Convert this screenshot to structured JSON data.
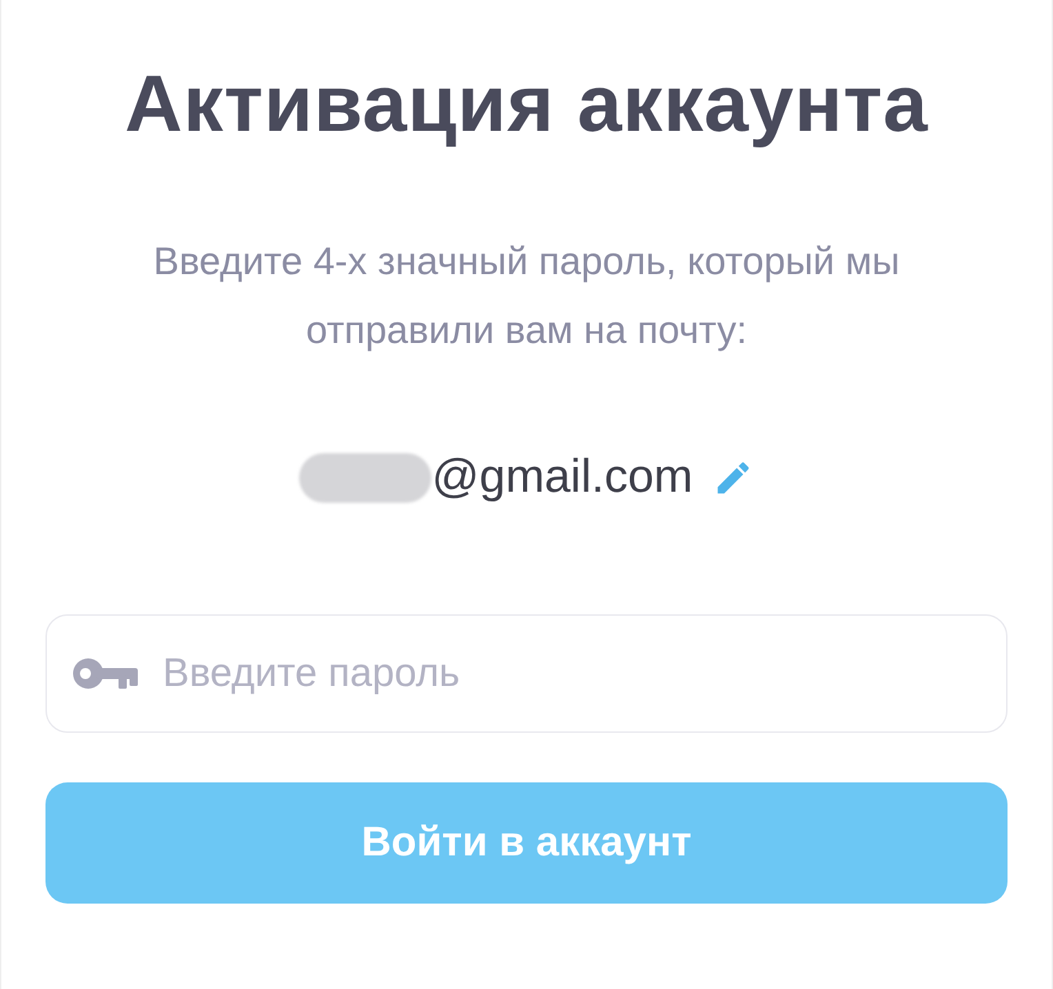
{
  "title": "Активация аккаунта",
  "instructions": "Введите 4-х значный пароль, который мы отправили вам на почту:",
  "email": {
    "visible_part": "@gmail.com",
    "redacted": true
  },
  "password_field": {
    "placeholder": "Введите пароль"
  },
  "submit_button": {
    "label": "Войти в аккаунт"
  }
}
